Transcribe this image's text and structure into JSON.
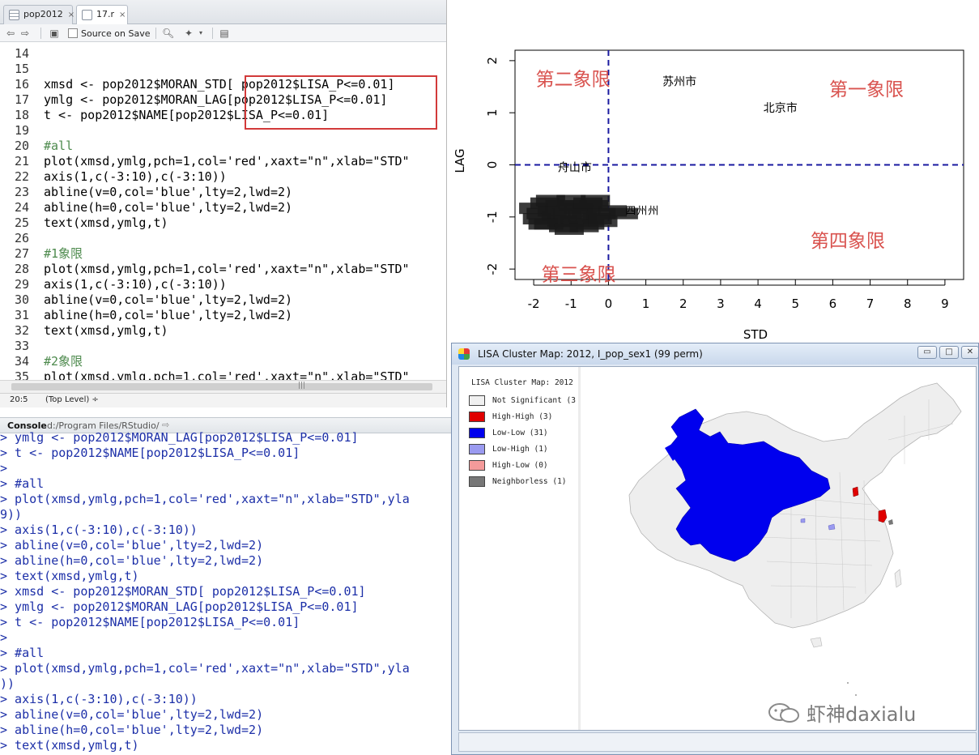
{
  "editor": {
    "tabs": [
      {
        "label": "pop2012",
        "close": "×"
      },
      {
        "label": "17.r",
        "close": "×"
      }
    ],
    "toolbar": {
      "source_on_save": "Source on Save"
    },
    "lines": [
      {
        "n": "14",
        "text": ""
      },
      {
        "n": "15",
        "text": ""
      },
      {
        "n": "16",
        "text": "xmsd <- pop2012$MORAN_STD[ pop2012$LISA_P<=0.01]"
      },
      {
        "n": "17",
        "text": "ymlg <- pop2012$MORAN_LAG[pop2012$LISA_P<=0.01]"
      },
      {
        "n": "18",
        "text": "t <- pop2012$NAME[pop2012$LISA_P<=0.01]"
      },
      {
        "n": "19",
        "text": ""
      },
      {
        "n": "20",
        "text": "#all"
      },
      {
        "n": "21",
        "text": "plot(xmsd,ymlg,pch=1,col='red',xaxt=\"n\",xlab=\"STD\""
      },
      {
        "n": "22",
        "text": "axis(1,c(-3:10),c(-3:10))"
      },
      {
        "n": "23",
        "text": "abline(v=0,col='blue',lty=2,lwd=2)"
      },
      {
        "n": "24",
        "text": "abline(h=0,col='blue',lty=2,lwd=2)"
      },
      {
        "n": "25",
        "text": "text(xmsd,ymlg,t)"
      },
      {
        "n": "26",
        "text": ""
      },
      {
        "n": "27",
        "text": "#1象限"
      },
      {
        "n": "28",
        "text": "plot(xmsd,ymlg,pch=1,col='red',xaxt=\"n\",xlab=\"STD\""
      },
      {
        "n": "29",
        "text": "axis(1,c(-3:10),c(-3:10))"
      },
      {
        "n": "30",
        "text": "abline(v=0,col='blue',lty=2,lwd=2)"
      },
      {
        "n": "31",
        "text": "abline(h=0,col='blue',lty=2,lwd=2)"
      },
      {
        "n": "32",
        "text": "text(xmsd,ymlg,t)"
      },
      {
        "n": "33",
        "text": ""
      },
      {
        "n": "34",
        "text": "#2象限"
      },
      {
        "n": "35",
        "text": "plot(xmsd,ymlg,pch=1,col='red',xaxt=\"n\",xlab=\"STD\""
      }
    ],
    "status": {
      "position": "20:5",
      "scope": "(Top Level) ÷"
    }
  },
  "console": {
    "title": "Console",
    "path": "d:/Program Files/RStudio/",
    "lines": [
      "> ymlg <- pop2012$MORAN_LAG[pop2012$LISA_P<=0.01]",
      "> t <- pop2012$NAME[pop2012$LISA_P<=0.01]",
      ">",
      "> #all",
      "> plot(xmsd,ymlg,pch=1,col='red',xaxt=\"n\",xlab=\"STD\",yla",
      "9))",
      "> axis(1,c(-3:10),c(-3:10))",
      "> abline(v=0,col='blue',lty=2,lwd=2)",
      "> abline(h=0,col='blue',lty=2,lwd=2)",
      "> text(xmsd,ymlg,t)",
      "> xmsd <- pop2012$MORAN_STD[ pop2012$LISA_P<=0.01]",
      "> ymlg <- pop2012$MORAN_LAG[pop2012$LISA_P<=0.01]",
      "> t <- pop2012$NAME[pop2012$LISA_P<=0.01]",
      ">",
      "> #all",
      "> plot(xmsd,ymlg,pch=1,col='red',xaxt=\"n\",xlab=\"STD\",yla",
      "))",
      "> axis(1,c(-3:10),c(-3:10))",
      "> abline(v=0,col='blue',lty=2,lwd=2)",
      "> abline(h=0,col='blue',lty=2,lwd=2)",
      "> text(xmsd,ymlg,t)"
    ]
  },
  "chart_data": {
    "type": "scatter",
    "xlabel": "STD",
    "ylabel": "LAG",
    "xlim": [
      -2.5,
      9.5
    ],
    "ylim": [
      -2.2,
      2.2
    ],
    "xticks": [
      -2,
      -1,
      0,
      1,
      2,
      3,
      4,
      5,
      6,
      7,
      8,
      9
    ],
    "yticks": [
      -2,
      -1,
      0,
      1,
      2
    ],
    "vline": 0,
    "hline": 0,
    "line_color": "#1a1aa0",
    "points": [
      {
        "x": 1.9,
        "y": 1.6,
        "label": "苏州市"
      },
      {
        "x": 4.6,
        "y": 1.1,
        "label": "北京市"
      },
      {
        "x": -0.9,
        "y": -0.05,
        "label": "舟山市"
      }
    ],
    "cluster_points": [
      {
        "x": -2.0,
        "y": -0.85
      },
      {
        "x": -1.9,
        "y": -1.05
      },
      {
        "x": -1.8,
        "y": -0.95
      },
      {
        "x": -1.7,
        "y": -0.75
      },
      {
        "x": -1.6,
        "y": -1.15
      },
      {
        "x": -1.5,
        "y": -0.9
      },
      {
        "x": -1.4,
        "y": -1.0
      },
      {
        "x": -1.3,
        "y": -0.8
      },
      {
        "x": -1.2,
        "y": -1.2
      },
      {
        "x": -1.1,
        "y": -0.95
      },
      {
        "x": -1.0,
        "y": -0.7
      },
      {
        "x": -0.9,
        "y": -1.1
      },
      {
        "x": -0.8,
        "y": -0.85
      },
      {
        "x": -0.7,
        "y": -1.0
      },
      {
        "x": -0.6,
        "y": -0.9
      },
      {
        "x": -0.5,
        "y": -1.15
      },
      {
        "x": -0.4,
        "y": -0.8
      },
      {
        "x": -0.3,
        "y": -1.05
      },
      {
        "x": -0.2,
        "y": -0.95
      },
      {
        "x": 0.1,
        "y": -0.9
      },
      {
        "x": 0.4,
        "y": -0.95
      },
      {
        "x": -1.55,
        "y": -0.7
      },
      {
        "x": -1.25,
        "y": -1.1
      },
      {
        "x": -0.95,
        "y": -0.8
      },
      {
        "x": -0.65,
        "y": -1.2
      },
      {
        "x": -0.35,
        "y": -0.7
      },
      {
        "x": -1.75,
        "y": -1.15
      },
      {
        "x": -0.15,
        "y": -1.1
      },
      {
        "x": -1.05,
        "y": -1.25
      },
      {
        "x": -0.55,
        "y": -0.75
      }
    ],
    "annotations": [
      {
        "x": -0.95,
        "y": 1.65,
        "text": "第二象限"
      },
      {
        "x": 6.9,
        "y": 1.45,
        "text": "第一象限"
      },
      {
        "x": -0.8,
        "y": -2.1,
        "text": "第三象限"
      },
      {
        "x": 6.4,
        "y": -1.45,
        "text": "第四象限"
      }
    ],
    "annotation_color": "#d9534f",
    "cluster_labels": [
      "四",
      "州",
      "州"
    ]
  },
  "lisa": {
    "title": "LISA Cluster Map: 2012, I_pop_sex1 (99 perm)",
    "buttons": {
      "minimize": "▭",
      "maximize": "□",
      "close": "✕"
    },
    "legend_title": "LISA Cluster Map: 2012",
    "legend": [
      {
        "label": "Not Significant (3",
        "color": "#f0f0f0"
      },
      {
        "label": "High-High (3)",
        "color": "#e00000"
      },
      {
        "label": "Low-Low (31)",
        "color": "#0000ee"
      },
      {
        "label": "Low-High (1)",
        "color": "#9a9af0"
      },
      {
        "label": "High-Low (0)",
        "color": "#f49a9a"
      },
      {
        "label": "Neighborless (1)",
        "color": "#777777"
      }
    ],
    "watermark": "虾神daxialu"
  }
}
